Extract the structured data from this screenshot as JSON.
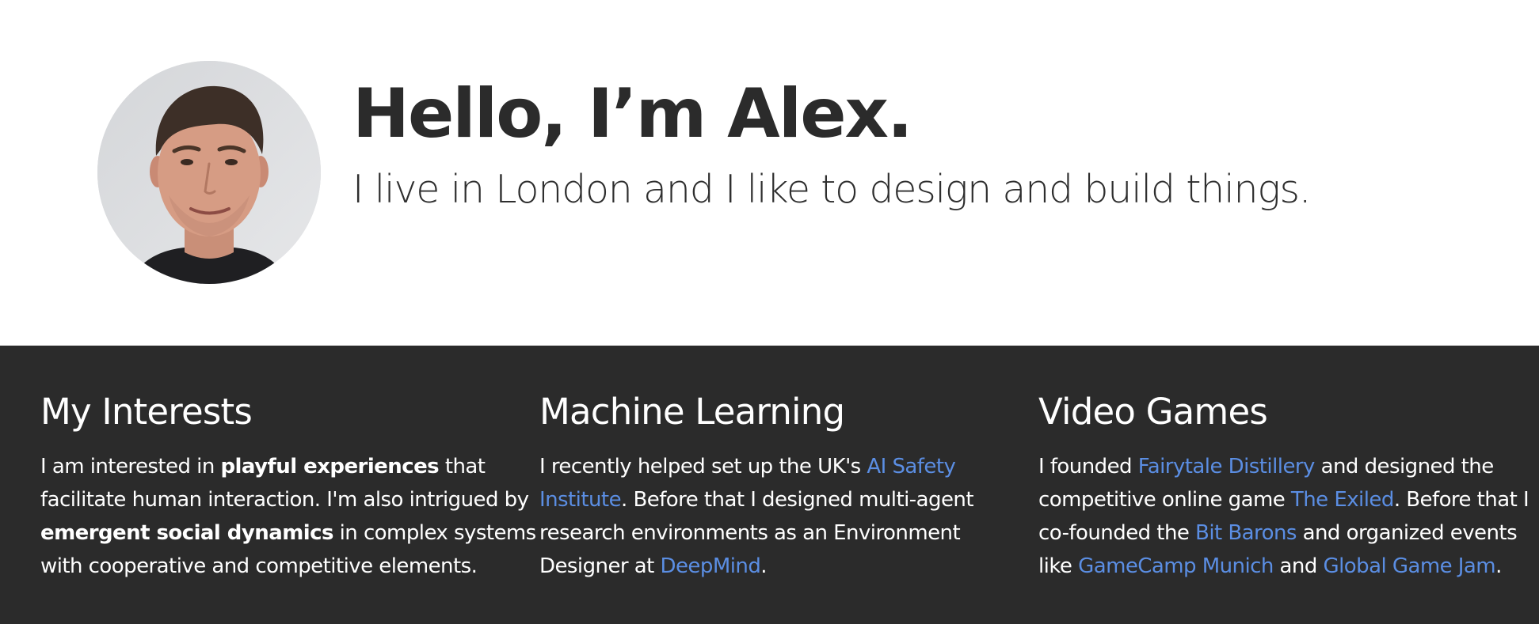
{
  "hero": {
    "title": "Hello, I’m Alex.",
    "subtitle": "I live in London and I like to design and build things."
  },
  "sections": [
    {
      "heading": "My Interests",
      "text": {
        "a": "I am interested in ",
        "b": "playful experiences",
        "c": " that",
        "d": "facilitate human interaction. I'm also intrigued by",
        "e": "emergent social dynamics",
        "f": " in complex systems",
        "g": "with cooperative and competitive elements."
      }
    },
    {
      "heading": "Machine Learning",
      "text": {
        "a": "I recently helped set up the UK's ",
        "link1a": "AI Safety",
        "link1b": "Institute",
        "b": ". Before that I designed multi-agent",
        "c": "research environments as an Environment",
        "d": "Designer at ",
        "link2": "DeepMind",
        "e": "."
      }
    },
    {
      "heading": "Video Games",
      "text": {
        "a": "I founded ",
        "link1": "Fairytale Distillery",
        "b": " and designed the",
        "c": "competitive online game ",
        "link2": "The Exiled",
        "d": ". Before that I",
        "e": "co-founded the ",
        "link3": "Bit Barons",
        "f": " and organized events",
        "g": "like ",
        "link4": "GameCamp Munich",
        "h": " and ",
        "link5": "Global Game Jam",
        "i": "."
      }
    }
  ],
  "colors": {
    "dark_background": "#2b2b2b",
    "link": "#5b8ee3",
    "heading_text": "#2b2b2b",
    "light_text": "#ffffff"
  },
  "icons": {
    "avatar": "profile-photo"
  }
}
